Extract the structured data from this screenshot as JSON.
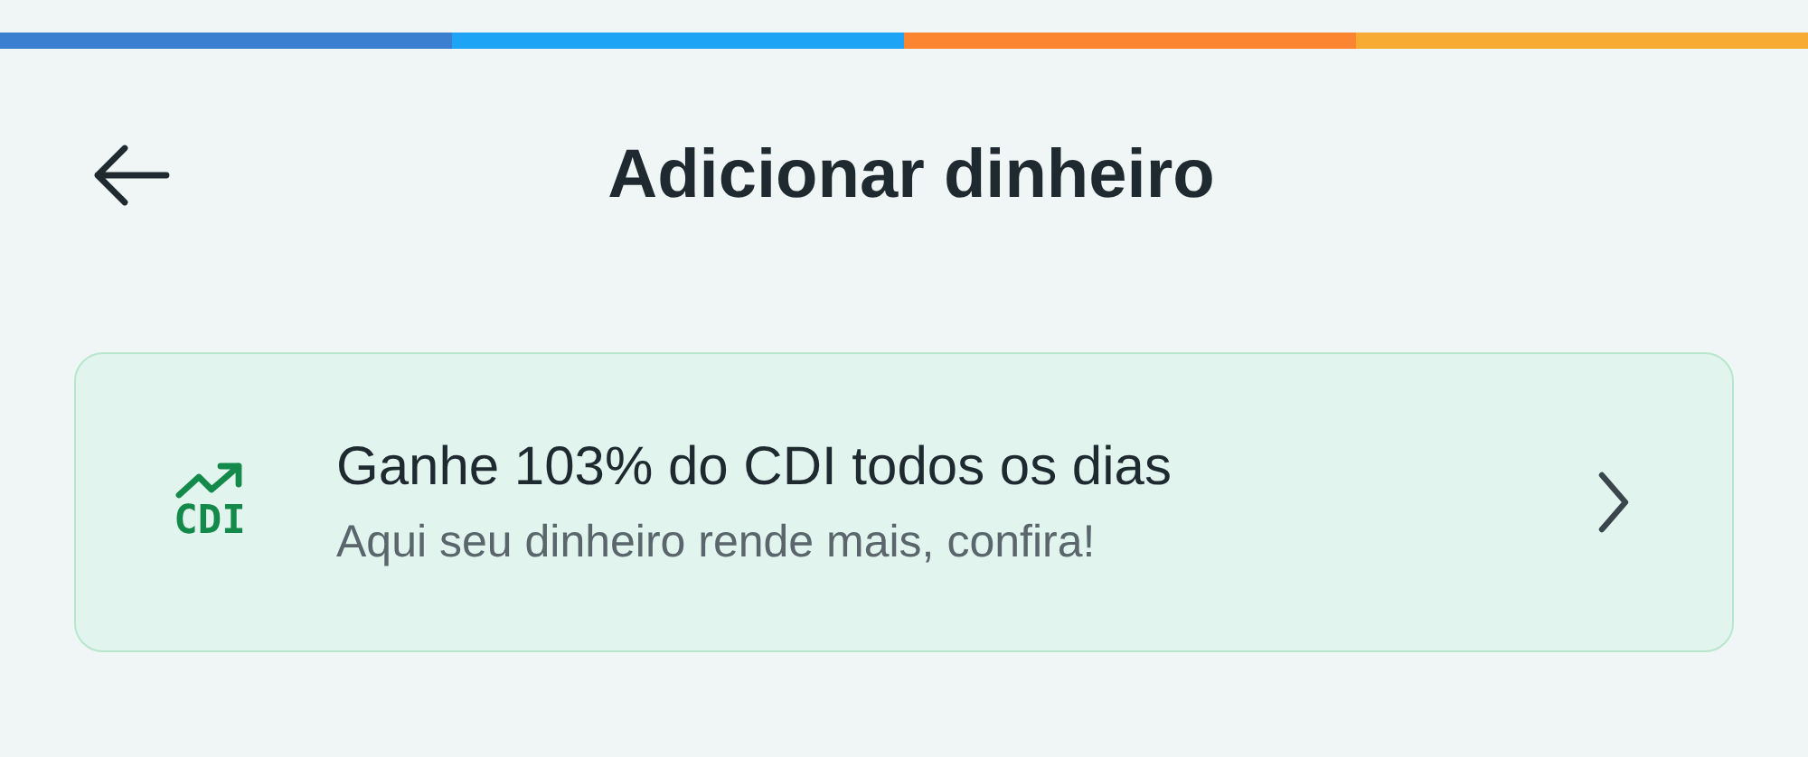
{
  "top_stripe": [
    {
      "color": "#3a7fd0"
    },
    {
      "color": "#1ea4f4"
    },
    {
      "color": "#fb8530"
    },
    {
      "color": "#f7ab33"
    }
  ],
  "header": {
    "title": "Adicionar dinheiro"
  },
  "promo_card": {
    "icon_text": "CDI",
    "title": "Ganhe 103% do CDI todos os dias",
    "subtitle": "Aqui seu dinheiro rende mais, confira!"
  }
}
